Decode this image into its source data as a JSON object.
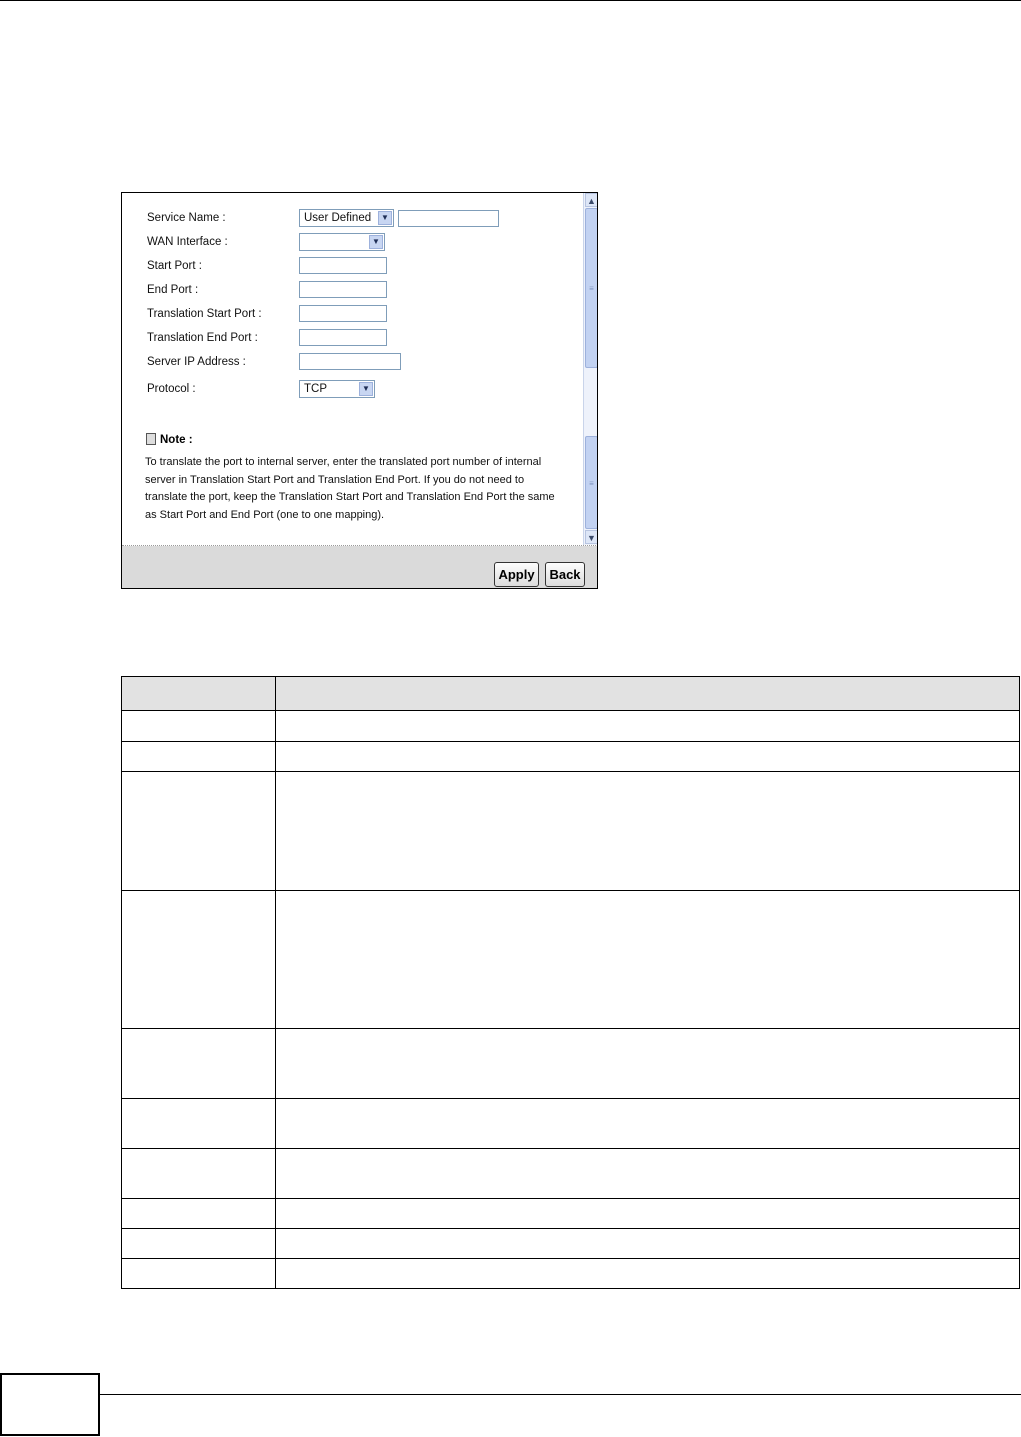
{
  "dialog": {
    "fields": {
      "service_name_label": "Service Name :",
      "service_name_value": "User Defined",
      "wan_interface_label": "WAN Interface :",
      "wan_interface_value": "",
      "start_port_label": "Start Port :",
      "end_port_label": "End Port :",
      "translation_start_port_label": "Translation Start Port :",
      "translation_end_port_label": "Translation End Port :",
      "server_ip_label": "Server IP Address :",
      "protocol_label": "Protocol :",
      "protocol_value": "TCP"
    },
    "note": {
      "title": "Note :",
      "text": " To translate the port to internal server, enter the translated port number of internal server in Translation Start Port and Translation End Port. If you do not need to translate the port, keep the Translation Start Port and Translation End Port the same as Start Port and End Port (one to one mapping)."
    },
    "buttons": {
      "apply": "Apply",
      "back": "Back"
    }
  },
  "table": {
    "row_count": 10
  }
}
